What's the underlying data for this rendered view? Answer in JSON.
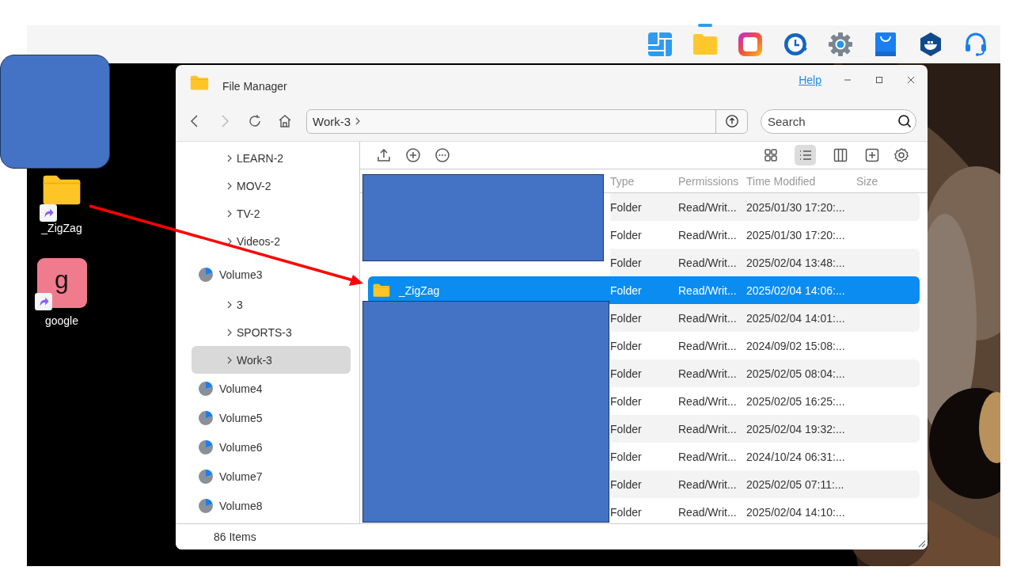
{
  "taskbar": {
    "apps": [
      {
        "kind": "tiles",
        "selected": false
      },
      {
        "kind": "files",
        "selected": true
      },
      {
        "kind": "photos",
        "selected": false
      },
      {
        "kind": "backup",
        "selected": false
      },
      {
        "kind": "settings",
        "selected": false
      },
      {
        "kind": "store",
        "selected": false
      },
      {
        "kind": "container",
        "selected": false
      },
      {
        "kind": "support",
        "selected": false
      }
    ]
  },
  "desktop": {
    "shortcuts": [
      {
        "kind": "folder",
        "label": "_ZigZag"
      },
      {
        "kind": "app",
        "label": "google",
        "glyph": "g"
      }
    ]
  },
  "window": {
    "title": "File Manager",
    "help": "Help"
  },
  "navigation": {
    "path": "Work-3"
  },
  "search": {
    "placeholder": "Search"
  },
  "sidebar": {
    "items": [
      {
        "kind": "folder",
        "label": "LEARN-2",
        "selected": false
      },
      {
        "kind": "folder",
        "label": "MOV-2",
        "selected": false
      },
      {
        "kind": "folder",
        "label": "TV-2",
        "selected": false
      },
      {
        "kind": "folder",
        "label": "Videos-2",
        "selected": false
      },
      {
        "kind": "volume",
        "label": "Volume3",
        "selected": false,
        "children": [
          {
            "kind": "folder",
            "label": "3",
            "selected": false
          },
          {
            "kind": "folder",
            "label": "SPORTS-3",
            "selected": false
          },
          {
            "kind": "folder",
            "label": "Work-3",
            "selected": true
          }
        ]
      },
      {
        "kind": "volume",
        "label": "Volume4",
        "selected": false
      },
      {
        "kind": "volume",
        "label": "Volume5",
        "selected": false
      },
      {
        "kind": "volume",
        "label": "Volume6",
        "selected": false
      },
      {
        "kind": "volume",
        "label": "Volume7",
        "selected": false
      },
      {
        "kind": "volume",
        "label": "Volume8",
        "selected": false
      }
    ]
  },
  "toolbar": {
    "actions": [
      {
        "kind": "upload"
      },
      {
        "kind": "create"
      },
      {
        "kind": "more"
      }
    ],
    "views": [
      {
        "kind": "grid",
        "selected": false
      },
      {
        "kind": "list",
        "selected": true
      },
      {
        "kind": "columns",
        "selected": false
      }
    ],
    "extras": [
      {
        "kind": "add"
      },
      {
        "kind": "settings"
      }
    ]
  },
  "table": {
    "columns": [
      "Type",
      "Permissions",
      "Time Modified",
      "Size"
    ],
    "rows": [
      {
        "type": "Folder",
        "permissions": "Read/Writ...",
        "modified": "2025/01/30 17:20:...",
        "selected": false
      },
      {
        "type": "Folder",
        "permissions": "Read/Writ...",
        "modified": "2025/01/30 17:20:...",
        "selected": false
      },
      {
        "type": "Folder",
        "permissions": "Read/Writ...",
        "modified": "2025/02/04 13:48:...",
        "selected": false
      },
      {
        "name": "_ZigZag",
        "type": "Folder",
        "permissions": "Read/Writ...",
        "modified": "2025/02/04 14:06:...",
        "selected": true
      },
      {
        "type": "Folder",
        "permissions": "Read/Writ...",
        "modified": "2025/02/04 14:01:...",
        "selected": false
      },
      {
        "type": "Folder",
        "permissions": "Read/Writ...",
        "modified": "2024/09/02 15:08:...",
        "selected": false
      },
      {
        "type": "Folder",
        "permissions": "Read/Writ...",
        "modified": "2025/02/05 08:04:...",
        "selected": false
      },
      {
        "type": "Folder",
        "permissions": "Read/Writ...",
        "modified": "2025/02/05 16:25:...",
        "selected": false
      },
      {
        "type": "Folder",
        "permissions": "Read/Writ...",
        "modified": "2025/02/04 19:32:...",
        "selected": false
      },
      {
        "type": "Folder",
        "permissions": "Read/Writ...",
        "modified": "2024/10/24 06:31:...",
        "selected": false
      },
      {
        "type": "Folder",
        "permissions": "Read/Writ...",
        "modified": "2025/02/05 07:11:...",
        "selected": false
      },
      {
        "type": "Folder",
        "permissions": "Read/Writ...",
        "modified": "2025/02/04 14:10:...",
        "selected": false
      }
    ]
  },
  "status_bar": {
    "count": "86 Items"
  },
  "annotations": [
    {
      "kind": "redaction"
    },
    {
      "kind": "redaction"
    },
    {
      "kind": "redaction"
    },
    {
      "kind": "arrow"
    }
  ]
}
